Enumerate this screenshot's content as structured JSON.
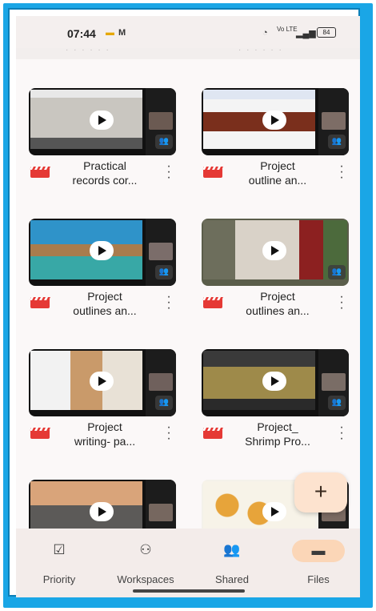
{
  "status_bar": {
    "time": "07:44",
    "battery": "84",
    "signal_text": "Vo LTE"
  },
  "top_faded": [
    "· · · · · ·",
    "· · · · · ·"
  ],
  "videos": [
    {
      "title_line1": "Practical",
      "title_line2": "records cor..."
    },
    {
      "title_line1": "Project",
      "title_line2": "outline an..."
    },
    {
      "title_line1": "Project",
      "title_line2": "outlines an..."
    },
    {
      "title_line1": "Project",
      "title_line2": "outlines an..."
    },
    {
      "title_line1": "Project",
      "title_line2": "writing- pa..."
    },
    {
      "title_line1": "Project_",
      "title_line2": "Shrimp Pro..."
    },
    {
      "title_line1": "",
      "title_line2": ""
    },
    {
      "title_line1": "",
      "title_line2": ""
    }
  ],
  "fab": {
    "label": "+"
  },
  "nav": [
    {
      "label": "Priority",
      "icon": "priority-icon"
    },
    {
      "label": "Workspaces",
      "icon": "workspaces-icon"
    },
    {
      "label": "Shared",
      "icon": "shared-icon"
    },
    {
      "label": "Files",
      "icon": "folder-icon",
      "active": true
    }
  ],
  "colors": {
    "accent": "#fbd6b7",
    "frame": "#1aa6e6",
    "video_icon": "#e53935"
  }
}
